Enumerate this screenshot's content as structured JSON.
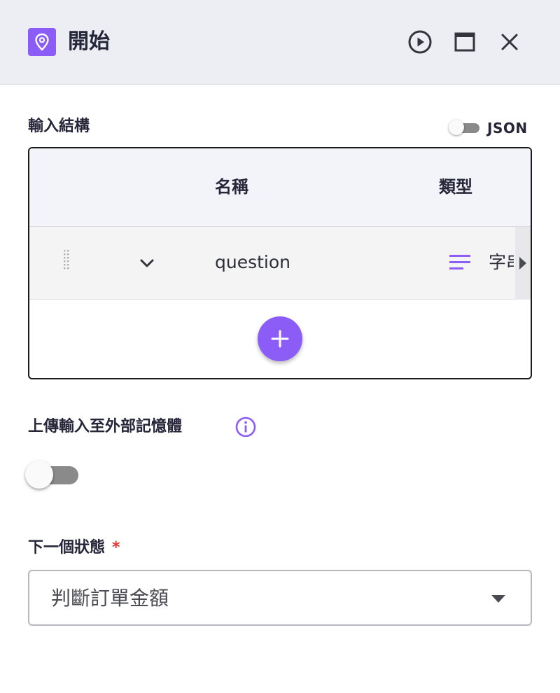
{
  "header": {
    "title": "開始",
    "node_icon": "map-pin-icon",
    "actions": {
      "play_icon": "play-circle-icon",
      "maximize_icon": "window-maximize-icon",
      "close_icon": "close-icon"
    }
  },
  "input_schema": {
    "label": "輸入結構",
    "json_toggle": {
      "label": "JSON",
      "on": false
    },
    "table": {
      "columns": [
        "名稱",
        "類型"
      ],
      "rows": [
        {
          "name": "question",
          "type": "字串",
          "type_icon": "text-lines-icon"
        }
      ],
      "add_icon": "plus-icon"
    }
  },
  "upload_to_memory": {
    "label": "上傳輸入至外部記憶體",
    "info_icon": "info-icon",
    "on": false
  },
  "next_state": {
    "label": "下一個狀態",
    "required_mark": "*",
    "selected": "判斷訂單金額"
  },
  "colors": {
    "accent": "#8b5cf6",
    "header_bg": "#eceef4",
    "required": "#e53935"
  }
}
